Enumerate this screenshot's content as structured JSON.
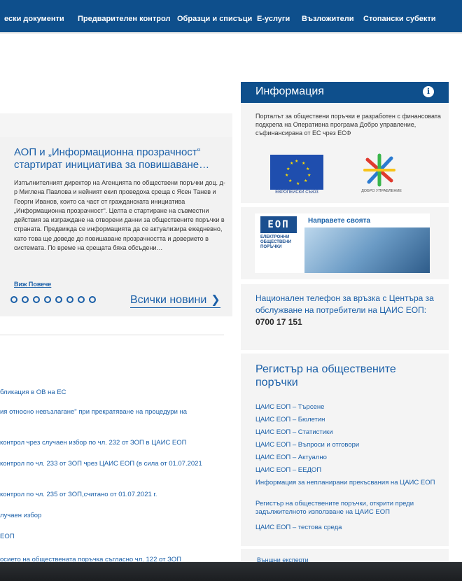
{
  "nav": {
    "items": [
      "ески документи",
      "Предварителен контрол",
      "Образци и списъци",
      "Е-услуги",
      "Възложители",
      "Стопански субекти"
    ]
  },
  "news": {
    "title": "АОП и „Информационна прозрачност“ стартират инициатива за повишаване…",
    "body": "Изпълнителният директор на Агенцията по обществени поръчки доц. д-р Миглена Павлова и нейният екип проведоха среща с Ясен Танев и Георги Иванов, които са част от гражданската инициатива „Информационна прозрачност“. Целта е стартиране на съвместни действия за изграждане на отворени данни за обществените поръчки в страната. Предвижда се информацията да се актуализира ежедневно, като това ще доведе до повишаване прозрачността и доверието в системата. По време на срещата бяха обсъдени…",
    "more_label": "Виж Повече",
    "all_news_label": "Всички новини",
    "chevron": "❯",
    "dot_count": 8
  },
  "left_links": [
    "бликация в ОВ на ЕС",
    "ия относно невъзлагане\" при прекратяване на процедури на",
    "контрол чрез случаен избор по чл. 232 от ЗОП в ЦАИС ЕОП",
    "контрол по чл. 233 от ЗОП чрез ЦАИС ЕОП (в сила от 01.07.2021",
    "контрол по чл. 235 от ЗОП,считано от 01.07.2021 г.",
    "лучаен избор",
    "ЕОП",
    "осието на обществената поръчка съгласно чл. 122 от ЗОП"
  ],
  "info_panel": {
    "title": "Информация",
    "icon": "i",
    "text": "Порталът за обществени поръчки е разработен с финансовата подкрепа на Оперативна програма Добро управление, съфинансирана от ЕС чрез ЕСФ",
    "eu_label": "ЕВРОПЕЙСКИ СЪЮЗ",
    "dobro_label": "ДОБРО УПРАВЛЕНИЕ"
  },
  "banner": {
    "logo": "ЕОП",
    "logo_text": "ЕЛЕКТРОННИ ОБЩЕСТВЕНИ ПОРЪЧКИ",
    "slogan": "Направете своята"
  },
  "phone": {
    "text": "Национален телефон за връзка с Центъра за обслужване на потребители на ЦАИС ЕОП:",
    "number": "0700 17 151"
  },
  "register": {
    "title": "Регистър на обществените поръчки",
    "links": [
      "ЦАИС ЕОП – Търсене",
      "ЦАИС ЕОП – Бюлетин",
      "ЦАИС ЕОП – Статистики",
      "ЦАИС ЕОП – Въпроси и отговори",
      "ЦАИС ЕОП – Актуално",
      "ЦАИС ЕОП – ЕЕДОП",
      "Информация за непланирани прекъсвания на ЦАИС ЕОП",
      "Регистър на обществените поръчки, открити преди задължителното използване на ЦАИС ЕОП",
      "ЦАИС ЕОП – тестова среда"
    ],
    "more_partial": "Външни експерти"
  }
}
